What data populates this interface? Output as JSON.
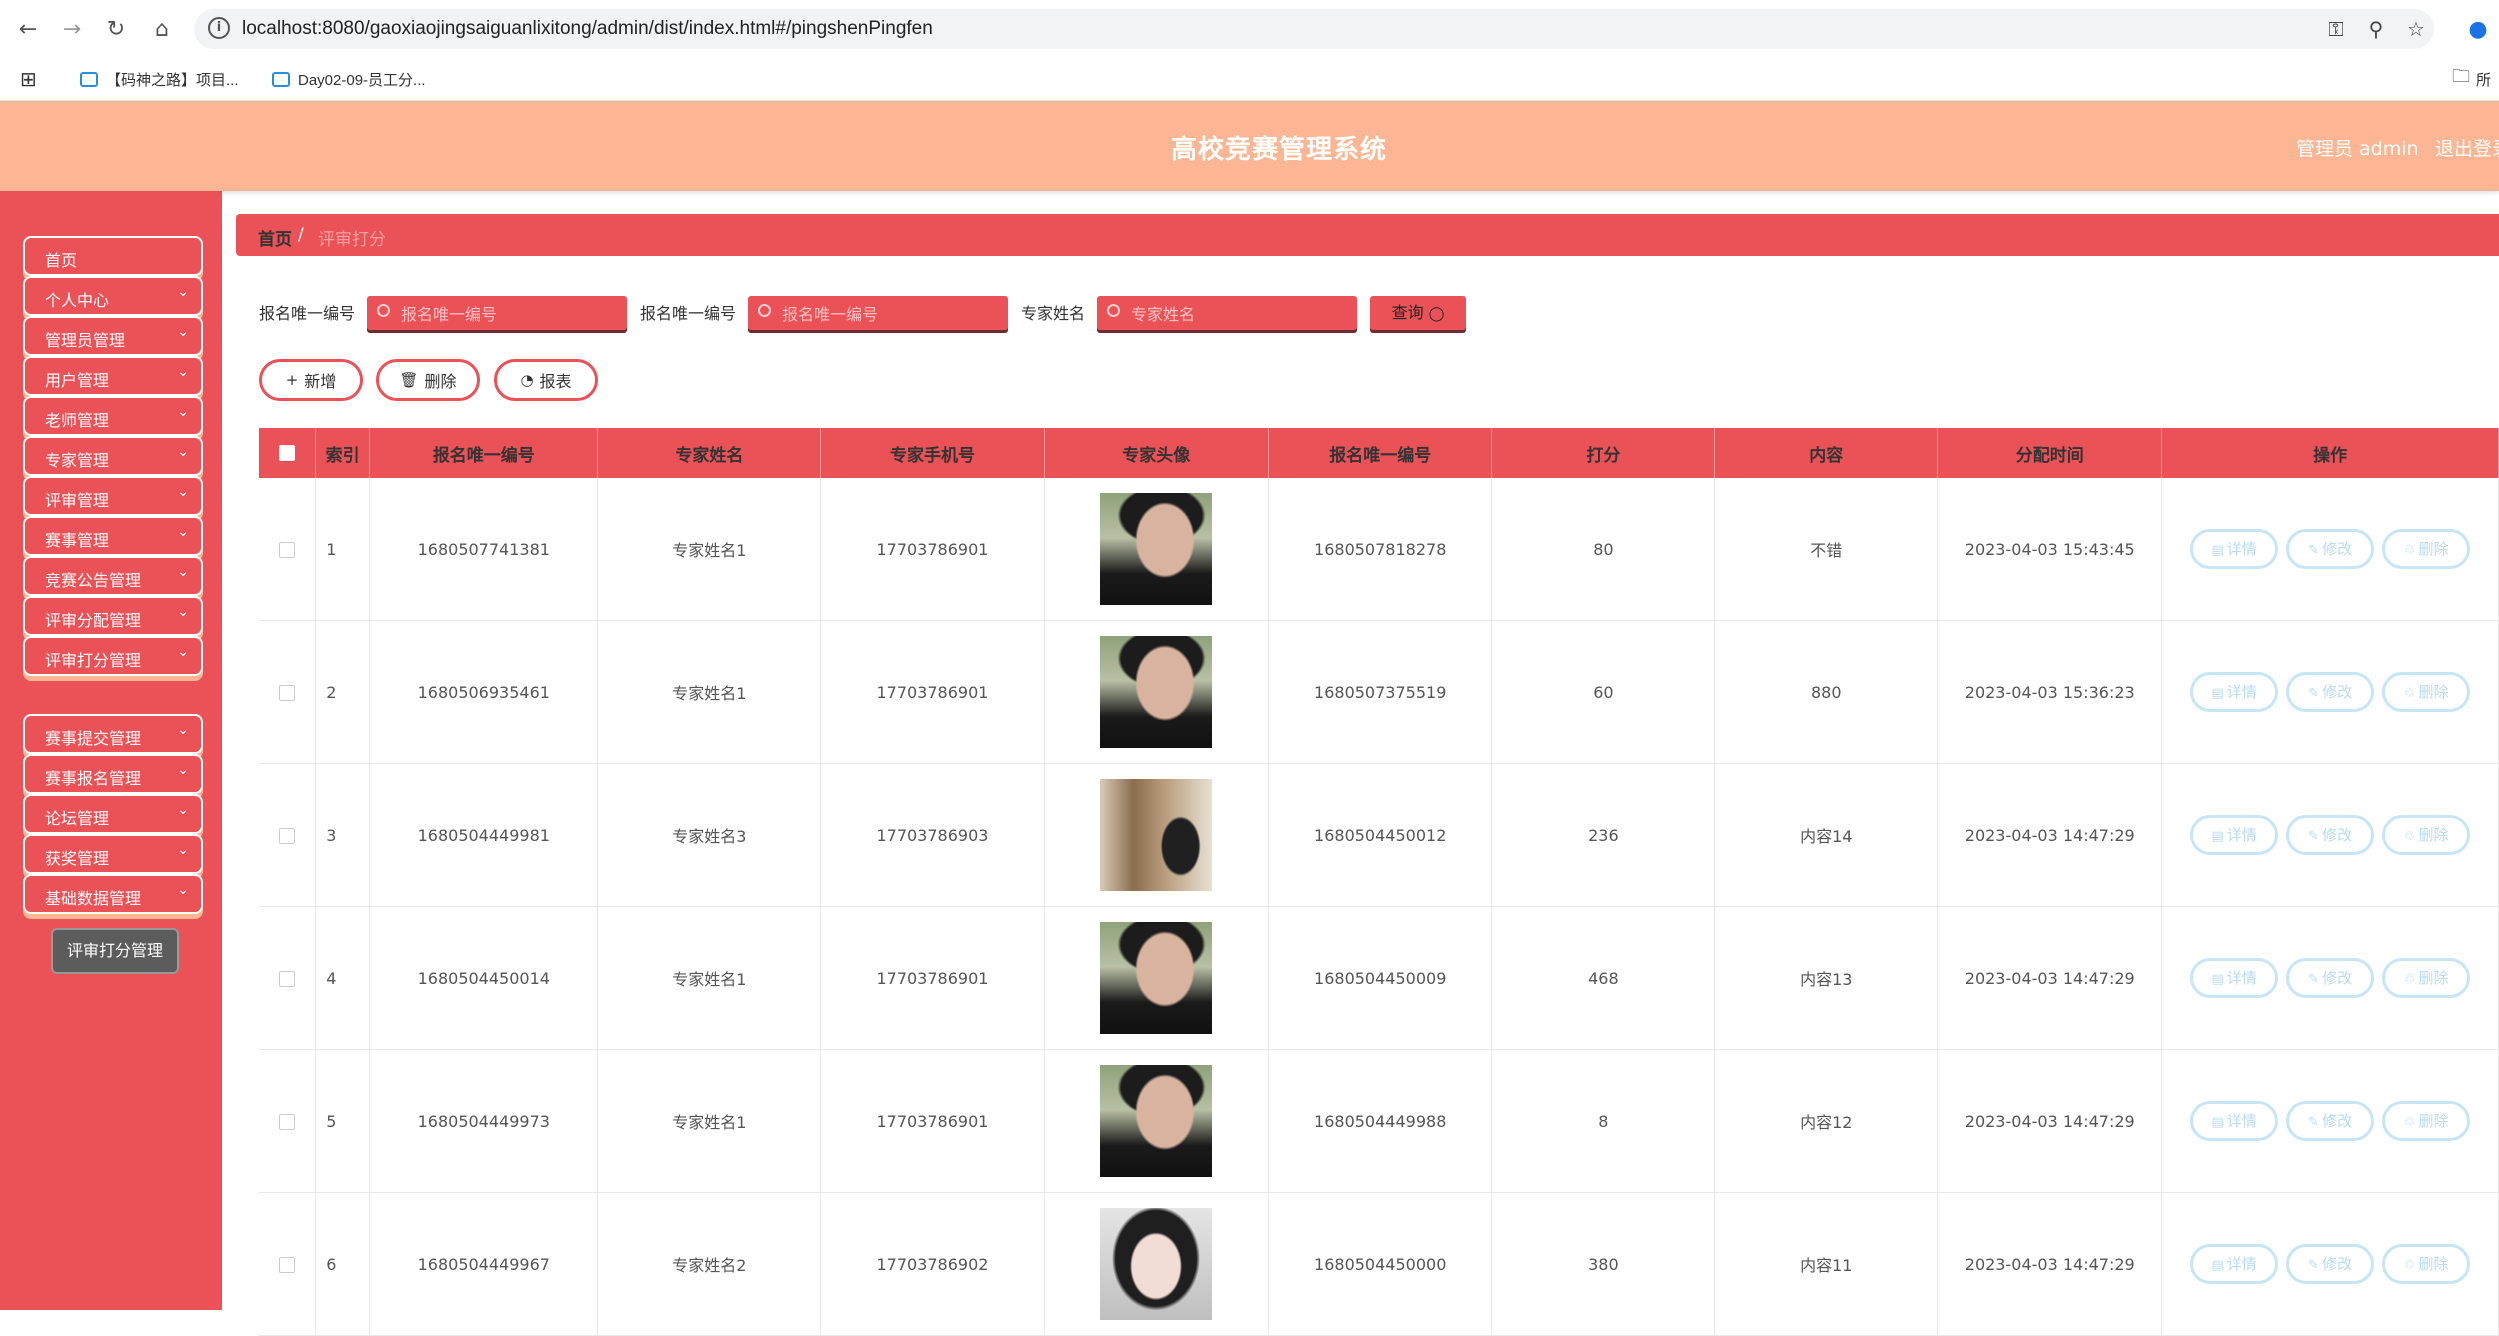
{
  "browser": {
    "url": "localhost:8080/gaoxiaojingsaiguanlixitong/admin/dist/index.html#/pingshenPingfen",
    "bookmarks": [
      "【码神之路】项目...",
      "Day02-09-员工分..."
    ],
    "bookmarks_right": "所"
  },
  "header": {
    "title": "高校竞赛管理系统",
    "user": "管理员 admin",
    "logout": "退出登录"
  },
  "sidebar": {
    "items": [
      {
        "label": "首页",
        "chevron": false
      },
      {
        "label": "个人中心",
        "chevron": true
      },
      {
        "label": "管理员管理",
        "chevron": true
      },
      {
        "label": "用户管理",
        "chevron": true
      },
      {
        "label": "老师管理",
        "chevron": true
      },
      {
        "label": "专家管理",
        "chevron": true
      },
      {
        "label": "评审管理",
        "chevron": true
      },
      {
        "label": "赛事管理",
        "chevron": true
      },
      {
        "label": "竞赛公告管理",
        "chevron": true
      },
      {
        "label": "评审分配管理",
        "chevron": true
      },
      {
        "label": "评审打分管理",
        "chevron": true
      },
      {
        "label": "赛事提交管理",
        "chevron": true
      },
      {
        "label": "赛事报名管理",
        "chevron": true
      },
      {
        "label": "论坛管理",
        "chevron": true
      },
      {
        "label": "获奖管理",
        "chevron": true
      },
      {
        "label": "基础数据管理",
        "chevron": true
      }
    ],
    "active_submenu": "评审打分管理"
  },
  "breadcrumb": {
    "home": "首页",
    "separator": "/",
    "current": "评审打分"
  },
  "search": {
    "fields": [
      {
        "label": "报名唯一编号",
        "placeholder": "报名唯一编号"
      },
      {
        "label": "报名唯一编号",
        "placeholder": "报名唯一编号"
      },
      {
        "label": "专家姓名",
        "placeholder": "专家姓名"
      }
    ],
    "query_label": "查询"
  },
  "actions": {
    "add": "新增",
    "delete": "删除",
    "report": "报表"
  },
  "table": {
    "columns": [
      "索引",
      "报名唯一编号",
      "专家姓名",
      "专家手机号",
      "专家头像",
      "报名唯一编号",
      "打分",
      "内容",
      "分配时间",
      "操作"
    ],
    "row_actions": {
      "detail": "详情",
      "edit": "修改",
      "delete": "删除"
    },
    "rows": [
      {
        "index": "1",
        "signup_no": "1680507741381",
        "expert_name": "专家姓名1",
        "phone": "17703786901",
        "avatar": "male",
        "signup_no2": "1680507818278",
        "score": "80",
        "content": "不错",
        "time": "2023-04-03 15:43:45"
      },
      {
        "index": "2",
        "signup_no": "1680506935461",
        "expert_name": "专家姓名1",
        "phone": "17703786901",
        "avatar": "male",
        "signup_no2": "1680507375519",
        "score": "60",
        "content": "880",
        "time": "2023-04-03 15:36:23"
      },
      {
        "index": "3",
        "signup_no": "1680504449981",
        "expert_name": "专家姓名3",
        "phone": "17703786903",
        "avatar": "painting",
        "signup_no2": "1680504450012",
        "score": "236",
        "content": "内容14",
        "time": "2023-04-03 14:47:29"
      },
      {
        "index": "4",
        "signup_no": "1680504450014",
        "expert_name": "专家姓名1",
        "phone": "17703786901",
        "avatar": "male",
        "signup_no2": "1680504450009",
        "score": "468",
        "content": "内容13",
        "time": "2023-04-03 14:47:29"
      },
      {
        "index": "5",
        "signup_no": "1680504449973",
        "expert_name": "专家姓名1",
        "phone": "17703786901",
        "avatar": "male",
        "signup_no2": "1680504449988",
        "score": "8",
        "content": "内容12",
        "time": "2023-04-03 14:47:29"
      },
      {
        "index": "6",
        "signup_no": "1680504449967",
        "expert_name": "专家姓名2",
        "phone": "17703786902",
        "avatar": "female",
        "signup_no2": "1680504450000",
        "score": "380",
        "content": "内容11",
        "time": "2023-04-03 14:47:29"
      }
    ]
  },
  "colors": {
    "primary": "#eb5257",
    "header": "#fcb693",
    "op_button": "#b9dcef"
  }
}
